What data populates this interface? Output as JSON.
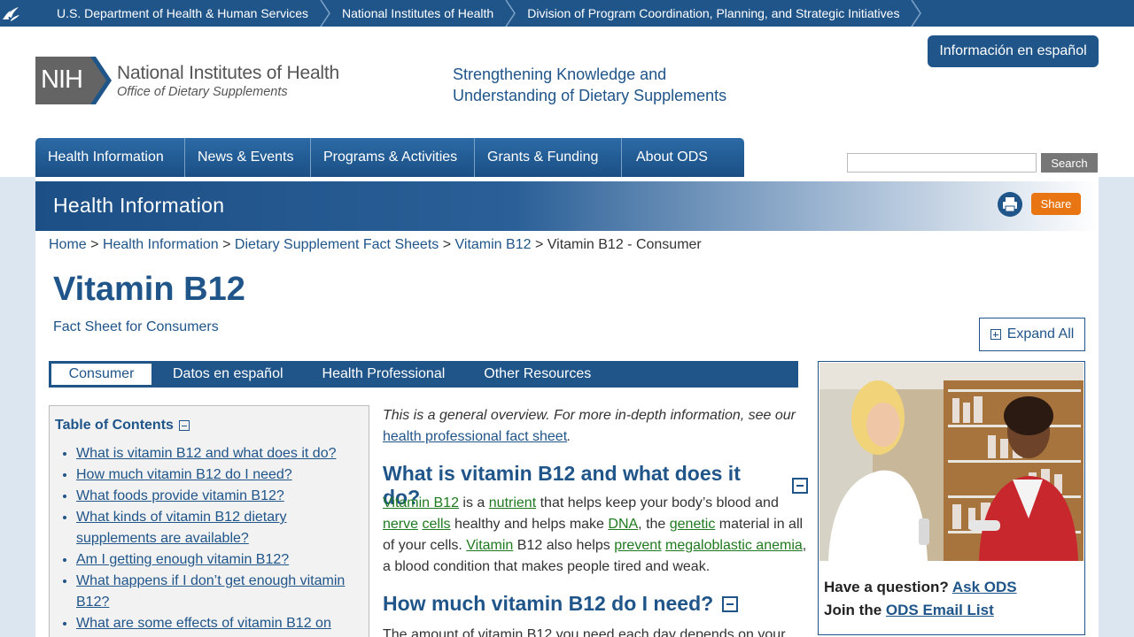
{
  "topbar": {
    "items": [
      {
        "label": "U.S. Department of Health & Human Services"
      },
      {
        "label": "National Institutes of Health"
      },
      {
        "label": "Division of Program Coordination, Planning, and Strategic Initiatives"
      }
    ]
  },
  "header": {
    "logo_mark": "NIH",
    "logo_title": "National Institutes of Health",
    "logo_subtitle": "Office of Dietary Supplements",
    "tagline_line1": "Strengthening Knowledge and",
    "tagline_line2": "Understanding of Dietary Supplements",
    "espanol_button": "Información en español",
    "search_button": "Search",
    "search_placeholder": ""
  },
  "nav": {
    "items": [
      {
        "label": "Health Information"
      },
      {
        "label": "News & Events"
      },
      {
        "label": "Programs & Activities"
      },
      {
        "label": "Grants & Funding"
      },
      {
        "label": "About ODS"
      }
    ]
  },
  "banner": {
    "title": "Health Information",
    "share_label": "Share"
  },
  "breadcrumb": {
    "items": [
      "Home",
      "Health Information",
      "Dietary Supplement Fact Sheets",
      "Vitamin B12"
    ],
    "separator": ">",
    "current": "Vitamin B12 - Consumer"
  },
  "page": {
    "title": "Vitamin B12",
    "subtitle": "Fact Sheet for Consumers",
    "expand_all": "Expand All"
  },
  "tabs": {
    "items": [
      {
        "label": "Consumer"
      },
      {
        "label": "Datos en español"
      },
      {
        "label": "Health Professional"
      },
      {
        "label": "Other Resources"
      }
    ]
  },
  "toc": {
    "title": "Table of Contents",
    "items": [
      "What is vitamin B12 and what does it do?",
      "How much vitamin B12 do I need?",
      "What foods provide vitamin B12?",
      "What kinds of vitamin B12 dietary supplements are available?",
      "Am I getting enough vitamin B12?",
      "What happens if I don’t get enough vitamin B12?",
      "What are some effects of vitamin B12 on"
    ]
  },
  "main": {
    "intro_text": "This is a general overview. For more in-depth information, see our",
    "intro_link": "health professional fact sheet",
    "intro_end": ".",
    "h2_1": "What is vitamin B12 and what does it do?",
    "para1": {
      "t1": "Vitamin B12",
      "t2": " is a ",
      "t3": "nutrient",
      "t4": " that helps keep your body’s blood and ",
      "t5": "nerve",
      "t6": " ",
      "t7": "cells",
      "t8": " healthy and helps make ",
      "t9": "DNA",
      "t10": ", the ",
      "t11": "genetic",
      "t12": " material in all of your cells. ",
      "t13": "Vitamin",
      "t14": " B12 also helps ",
      "t15": "prevent",
      "t16": " ",
      "t17": "megaloblastic anemia",
      "t18": ", a blood condition that makes people tired and weak."
    },
    "h2_2": "How much vitamin B12 do I need?",
    "para2": "The amount of vitamin B12 you need each day depends on your"
  },
  "sidebar": {
    "question": "Have a question?",
    "ask_link": "Ask ODS",
    "join": "Join the",
    "email_link": "ODS Email List"
  },
  "colors": {
    "primary": "#20558a",
    "link_green": "#1f7a1f",
    "share_orange": "#e87511",
    "page_bg": "#dce6f1"
  }
}
